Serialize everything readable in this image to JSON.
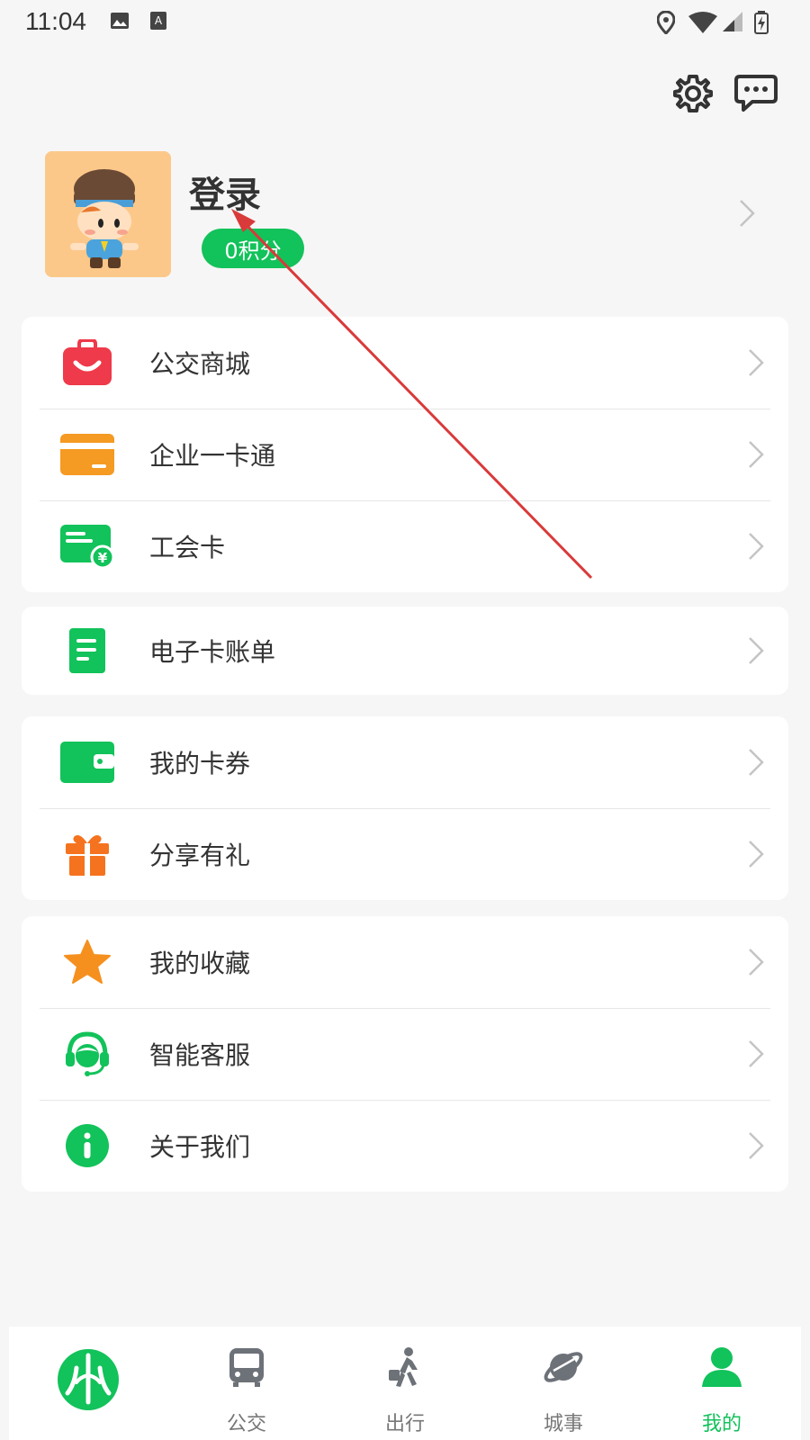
{
  "status_bar": {
    "time": "11:04",
    "icons": [
      "image-icon",
      "a-icon",
      "location-icon",
      "wifi-icon",
      "signal-icon",
      "battery-icon"
    ]
  },
  "header": {
    "settings_icon": "gear-icon",
    "messages_icon": "chat-icon"
  },
  "profile": {
    "login_label": "登录",
    "points_label": "0积分"
  },
  "menu_groups": [
    {
      "items": [
        {
          "label": "公交商城",
          "icon": "shopping-bag-icon"
        },
        {
          "label": "企业一卡通",
          "icon": "card-icon"
        },
        {
          "label": "工会卡",
          "icon": "union-card-icon"
        }
      ]
    },
    {
      "items": [
        {
          "label": "电子卡账单",
          "icon": "bill-icon"
        }
      ]
    },
    {
      "items": [
        {
          "label": "我的卡券",
          "icon": "wallet-icon"
        },
        {
          "label": "分享有礼",
          "icon": "gift-icon"
        }
      ]
    },
    {
      "items": [
        {
          "label": "我的收藏",
          "icon": "star-icon"
        },
        {
          "label": "智能客服",
          "icon": "headset-icon"
        },
        {
          "label": "关于我们",
          "icon": "info-icon"
        }
      ]
    }
  ],
  "tabbar": {
    "tabs": [
      {
        "label": "",
        "icon": "app-logo-icon"
      },
      {
        "label": "公交",
        "icon": "bus-icon"
      },
      {
        "label": "出行",
        "icon": "walking-icon"
      },
      {
        "label": "城事",
        "icon": "planet-icon"
      },
      {
        "label": "我的",
        "icon": "person-icon",
        "active": true
      }
    ]
  },
  "colors": {
    "accent": "#12c25a",
    "orange": "#f59a23",
    "red": "#ee3a4a",
    "annotation_arrow": "#d93a3a"
  }
}
